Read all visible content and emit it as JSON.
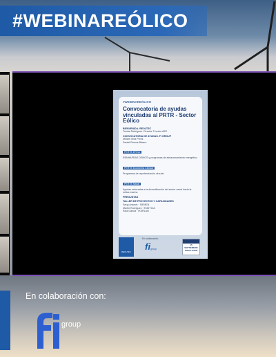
{
  "header": {
    "title": "#WEBINAREÓLICO"
  },
  "slide": {
    "tag": "#WEBINAREÓLICO",
    "title": "Convocatoria de ayudas vinculadas al PRTR - Sector Eólico",
    "items": [
      {
        "type": "bullet",
        "text": "BIENVENIDA. REOLTEC"
      },
      {
        "type": "row",
        "text": "Tomás Rodríguez. Director Técnico AEE"
      },
      {
        "type": "bullet",
        "text": "CONVOCATORIA DE AYUDAS. FI GROUP"
      },
      {
        "type": "row",
        "text": "Miriam Vera Pérez"
      },
      {
        "type": "row",
        "text": "Daniel Ramos Blasco"
      },
      {
        "type": "chip",
        "text": "PERTE ERHA"
      },
      {
        "type": "row",
        "text": "RENHAPRAS DEMOS y programas de almacenamiento energético"
      },
      {
        "type": "chip",
        "text": "PERTE Economía Circular"
      },
      {
        "type": "row",
        "text": "Programas de repotenciación circular"
      },
      {
        "type": "chip",
        "text": "PERTE Naval"
      },
      {
        "type": "row",
        "text": "Ayudas enfocadas a la diversificación del sector naval hacia la eólica marina"
      },
      {
        "type": "bullet",
        "text": "PREGUNTAS"
      },
      {
        "type": "bullet",
        "text": "TALLER DE PROYECTOS Y CAPACIDADES"
      },
      {
        "type": "row",
        "text": "Sergi Ansotet · SIEMEN"
      },
      {
        "type": "row",
        "text": "Martin Rodriguez · ENGYCIA"
      },
      {
        "type": "row",
        "text": "Raúl García · IKERLAN"
      }
    ],
    "footer": {
      "logo_text": "REOLTEC",
      "collab": "En colaboración:",
      "fi_mark": "fi",
      "fi_group": "group",
      "date_day": "15",
      "date_month": "SEPTIEMBRE",
      "date_time": "10H00-12H00"
    }
  },
  "collab": {
    "label": "En colaboración con:",
    "fi_mark": "fi",
    "group": "group"
  },
  "colors": {
    "title_bar": "#1e5aa6",
    "frame_border": "#7b4fb5",
    "fi_blue": "#1e5aa6"
  }
}
